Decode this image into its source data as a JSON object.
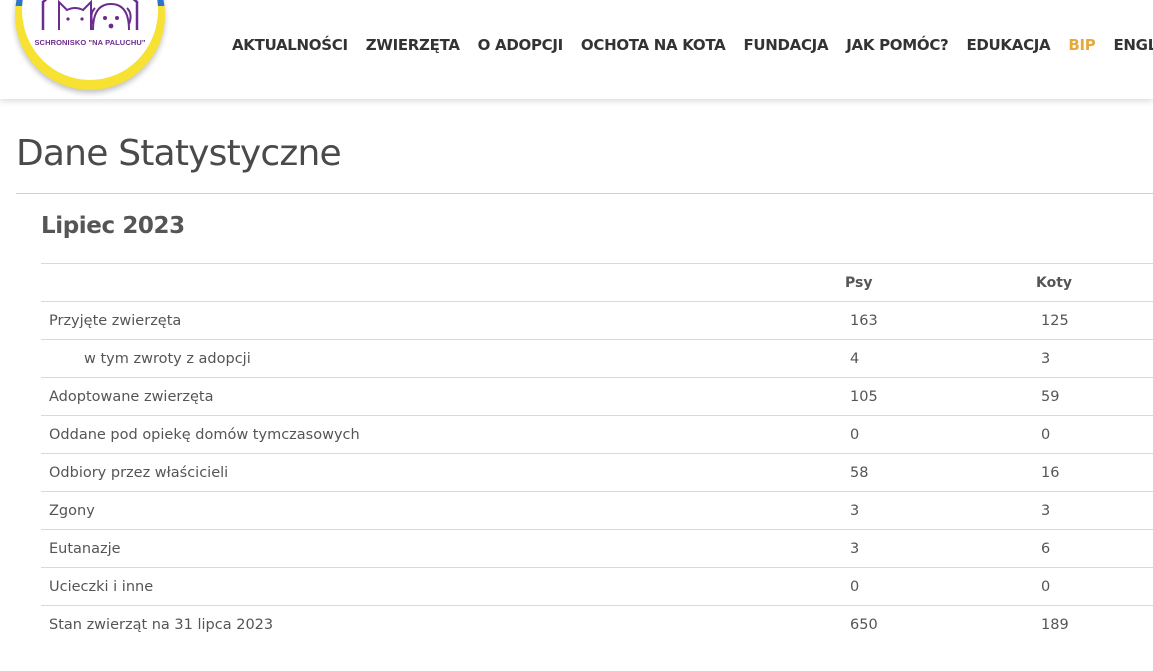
{
  "logo": {
    "text": "SCHRONISKO \"NA PALUCHU\"",
    "colors": {
      "ring": "#f7e234",
      "top": "#2c73c9",
      "ink": "#6a2c8e"
    }
  },
  "nav": {
    "items": [
      {
        "label": "AKTUALNOŚCI",
        "active": false
      },
      {
        "label": "ZWIERZĘTA",
        "active": false
      },
      {
        "label": "O ADOPCJI",
        "active": false
      },
      {
        "label": "OCHOTA NA KOTA",
        "active": false
      },
      {
        "label": "FUNDACJA",
        "active": false
      },
      {
        "label": "JAK POMÓC?",
        "active": false
      },
      {
        "label": "EDUKACJA",
        "active": false
      },
      {
        "label": "BIP",
        "active": true
      },
      {
        "label": "ENGLIS",
        "active": false
      }
    ],
    "active_color": "#e8a93c"
  },
  "page": {
    "title": "Dane Statystyczne",
    "section_title": "Lipiec 2023"
  },
  "table": {
    "headers": {
      "label": "",
      "psy": "Psy",
      "koty": "Koty"
    },
    "rows": [
      {
        "label": "Przyjęte zwierzęta",
        "psy": "163",
        "koty": "125",
        "indent": false
      },
      {
        "label": "w tym zwroty z adopcji",
        "psy": "4",
        "koty": "3",
        "indent": true
      },
      {
        "label": "Adoptowane zwierzęta",
        "psy": "105",
        "koty": "59",
        "indent": false
      },
      {
        "label": "Oddane pod opiekę domów tymczasowych",
        "psy": "0",
        "koty": "0",
        "indent": false
      },
      {
        "label": "Odbiory przez właścicieli",
        "psy": "58",
        "koty": "16",
        "indent": false
      },
      {
        "label": "Zgony",
        "psy": "3",
        "koty": "3",
        "indent": false
      },
      {
        "label": "Eutanazje",
        "psy": "3",
        "koty": "6",
        "indent": false
      },
      {
        "label": "Ucieczki i inne",
        "psy": "0",
        "koty": "0",
        "indent": false
      },
      {
        "label": "Stan zwierząt na 31 lipca 2023",
        "psy": "650",
        "koty": "189",
        "indent": false
      }
    ]
  }
}
